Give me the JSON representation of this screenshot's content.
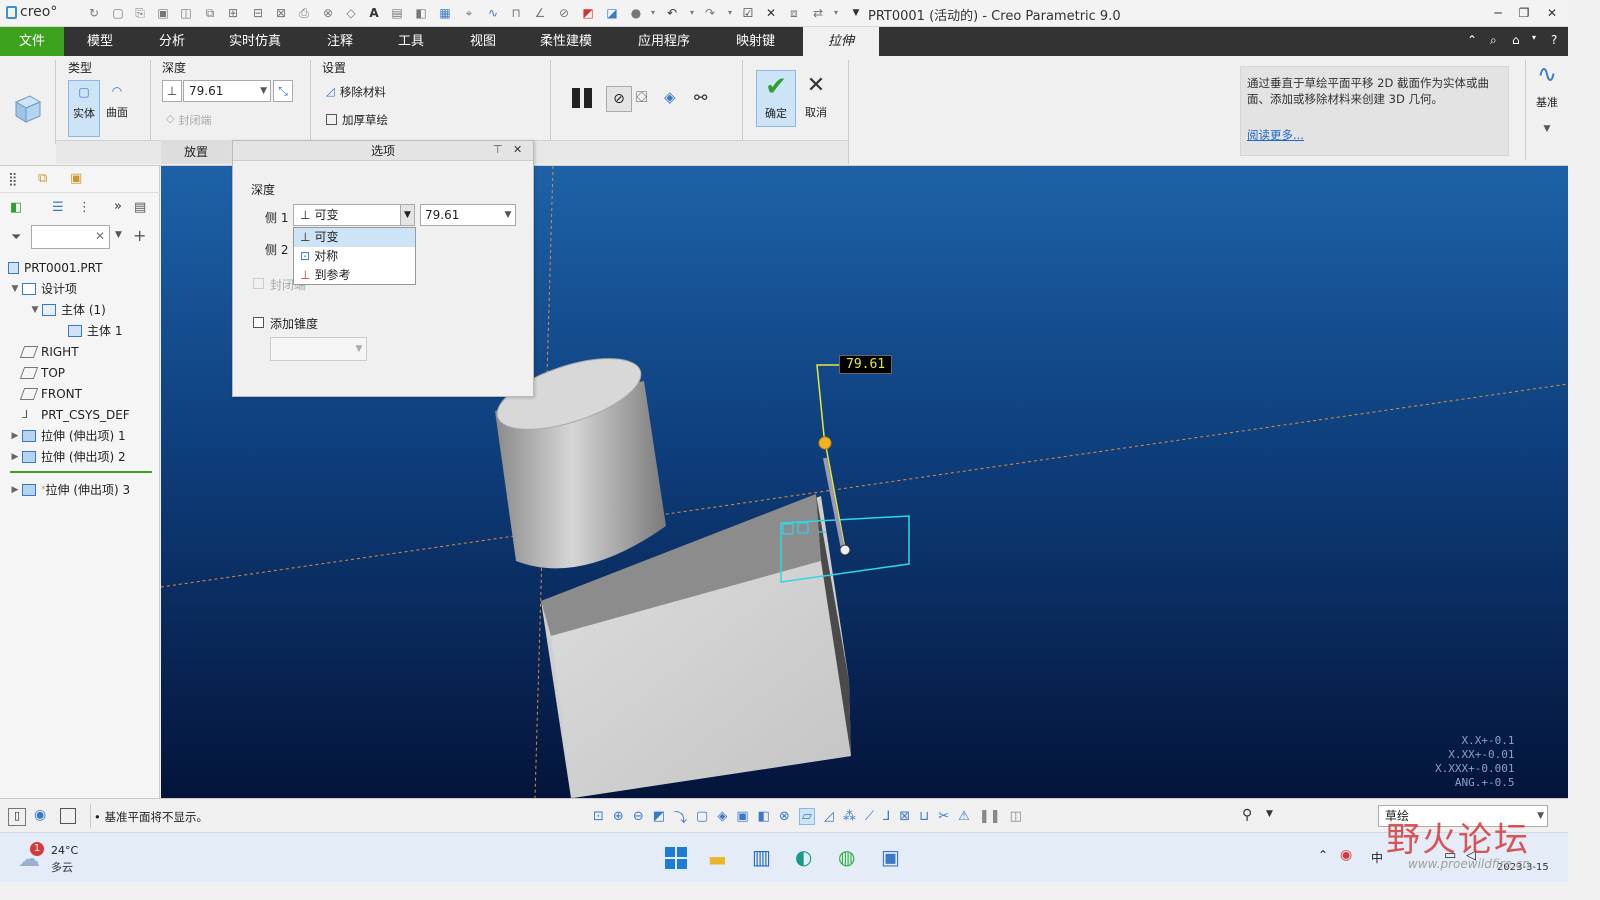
{
  "app": {
    "logo_text": "creo°",
    "window_title": "PRT0001 (活动的) - Creo Parametric 9.0"
  },
  "menu": {
    "items": [
      "文件",
      "模型",
      "分析",
      "实时仿真",
      "注释",
      "工具",
      "视图",
      "柔性建模",
      "应用程序",
      "映射键",
      "拉伸"
    ]
  },
  "ribbon": {
    "type_group": {
      "label": "类型",
      "solid": "实体",
      "surface": "曲面"
    },
    "depth_group": {
      "label": "深度",
      "value": "79.61",
      "closed": "封闭端"
    },
    "settings_group": {
      "label": "设置",
      "remove": "移除材料",
      "thicken": "加厚草绘"
    },
    "confirm": "确定",
    "cancel": "取消",
    "datum": "基准",
    "tabs": {
      "place": "放置",
      "options": "选项"
    },
    "help_text": "通过垂直于草绘平面平移 2D 截面作为实体或曲面、添加或移除材料来创建 3D 几何。",
    "help_link": "阅读更多..."
  },
  "options_panel": {
    "depth_label": "深度",
    "side1": "侧 1",
    "side2": "侧 2",
    "side1_type": "可变",
    "side1_value": "79.61",
    "dropdown": [
      "可变",
      "对称",
      "到参考"
    ],
    "closed_end": "封闭端",
    "add_taper": "添加锥度"
  },
  "tree": {
    "items": [
      {
        "label": "PRT0001.PRT"
      },
      {
        "label": "设计项"
      },
      {
        "label": "主体 (1)"
      },
      {
        "label": "主体 1"
      },
      {
        "label": "RIGHT"
      },
      {
        "label": "TOP"
      },
      {
        "label": "FRONT"
      },
      {
        "label": "PRT_CSYS_DEF"
      },
      {
        "label": "拉伸 (伸出项) 1"
      },
      {
        "label": "拉伸 (伸出项) 2"
      },
      {
        "label": "拉伸 (伸出项) 3"
      }
    ]
  },
  "viewport": {
    "dimension": "79.61",
    "tolerances": [
      "X.X+-0.1",
      "X.XX+-0.01",
      "X.XXX+-0.001",
      "ANG.+-0.5"
    ]
  },
  "status": {
    "message": "基准平面将不显示。",
    "filter_value": "草绘"
  },
  "taskbar": {
    "weather_temp": "24°C",
    "weather_desc": "多云",
    "weather_badge": "1",
    "date": "2023-3-15",
    "ime": "中"
  },
  "watermark": {
    "text": "野火论坛",
    "url": "www.proewildfire.cn"
  },
  "colors": {
    "accent": "#3da31f",
    "menubar": "#333333",
    "selection": "#cde4f7",
    "sketch": "#2fd6e6",
    "dim": "#e8e832"
  }
}
